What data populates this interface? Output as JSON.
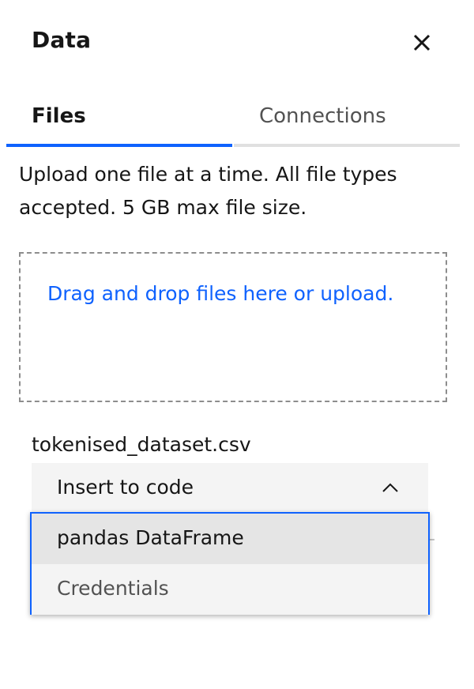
{
  "header": {
    "title": "Data",
    "close_icon": "close-icon"
  },
  "tabs": [
    {
      "label": "Files",
      "selected": true
    },
    {
      "label": "Connections",
      "selected": false
    }
  ],
  "upload": {
    "info": "Upload one file at a time. All file types accepted. 5 GB max file size.",
    "dropzone_text": "Drag and drop files here or upload."
  },
  "file": {
    "name": "tokenised_dataset.csv",
    "select_label": "Insert to code",
    "chevron_icon": "chevron-up-icon",
    "options": [
      "pandas DataFrame",
      "Credentials"
    ]
  },
  "colors": {
    "accent": "#0f62fe",
    "menu_bg": "#f4f4f4",
    "menu_hover": "#e5e5e5"
  }
}
